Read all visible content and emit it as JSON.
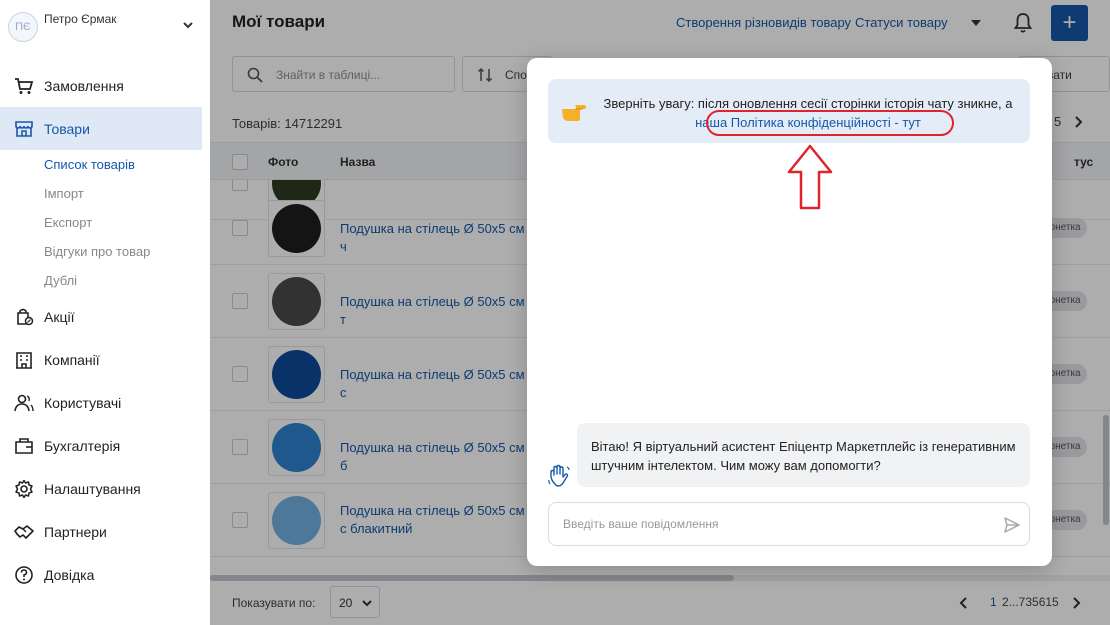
{
  "user": {
    "initials": "ПЄ",
    "name": "Петро Єрмак"
  },
  "nav": {
    "items": [
      {
        "label": "Замовлення",
        "icon": "cart-icon"
      },
      {
        "label": "Товари",
        "icon": "store-icon",
        "active": true
      },
      {
        "label": "Акції",
        "icon": "promo-icon"
      },
      {
        "label": "Компанії",
        "icon": "building-icon"
      },
      {
        "label": "Користувачі",
        "icon": "users-icon"
      },
      {
        "label": "Бухгалтерія",
        "icon": "wallet-icon"
      },
      {
        "label": "Налаштування",
        "icon": "gear-icon"
      },
      {
        "label": "Партнери",
        "icon": "handshake-icon"
      },
      {
        "label": "Довідка",
        "icon": "help-icon"
      }
    ],
    "sub": [
      "Список товарів",
      "Імпорт",
      "Експорт",
      "Відгуки про товар",
      "Дублі"
    ]
  },
  "header": {
    "title": "Мої товари",
    "link_variants": "Створення різновидів товару",
    "link_statuses": "Статуси товару",
    "plus": "+"
  },
  "toolbar": {
    "search_placeholder": "Знайти в таблиці...",
    "sort_label": "Спо",
    "right_label": "вати"
  },
  "summary": {
    "count": "Товарів: 14712291",
    "page_tr": "5"
  },
  "table": {
    "col_photo": "Фото",
    "col_name": "Назва",
    "col_status": "тус",
    "rows": [
      {
        "name": "",
        "status": "",
        "color": "#2f3a22"
      },
      {
        "name": "Подушка на стілець Ø 50х5 см ч",
        "status": "ернетка",
        "color": "#1e1e1e"
      },
      {
        "name": "Подушка на стілець Ø 50х5 см т",
        "status": "ернетка",
        "color": "#4a4a4c"
      },
      {
        "name": "Подушка на стілець Ø 50х5 см с",
        "status": "ернетка",
        "color": "#0d4a9a"
      },
      {
        "name": "Подушка на стілець Ø 50х5 см б",
        "status": "ернетка",
        "color": "#2d82d0"
      },
      {
        "name": "Подушка на стілець Ø 50х5 см с блакитний",
        "status": "ернетка",
        "color": "#72b2e2"
      }
    ]
  },
  "footer": {
    "per_page_label": "Показувати по:",
    "per_page": "20",
    "page_current": "1",
    "page_rest": "2...735615"
  },
  "chat": {
    "notice_text": "Зверніть увагу: після оновлення сесії сторінки історія чату зникне, а",
    "notice_link": "наша Політика конфіденційності - тут",
    "bot_message": "Вітаю! Я віртуальний асистент Епіцентр Маркетплейс із генеративним штучним інтелектом. Чим можу вам допомогти?",
    "input_placeholder": "Введіть ваше повідомлення"
  },
  "colors": {
    "accent": "#1658a8",
    "highlight": "#e0242c"
  }
}
